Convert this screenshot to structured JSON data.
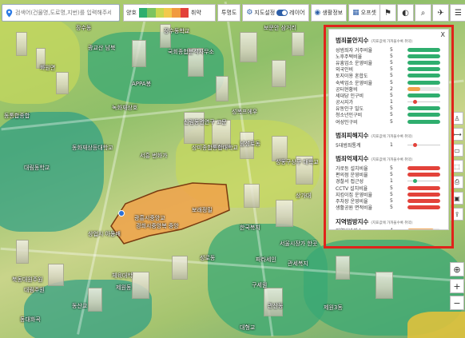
{
  "search": {
    "placeholder": "검색어(건물명,도로명,지번)를 입력해주세요."
  },
  "legend": {
    "safe_label": "양호",
    "danger_label": "취약",
    "colors": [
      "#2fae6e",
      "#7cc45f",
      "#c9d64f",
      "#f2c94c",
      "#f19a3e",
      "#e3423a"
    ]
  },
  "toolbar": {
    "opacity_label": "투명도",
    "map_setting_label": "지도설정",
    "layer_label": "레이어",
    "life_info_label": "생활정보",
    "off_label": "오프셋"
  },
  "colors": {
    "accent": "#2c5ea8",
    "highlight": "#e0231b",
    "good": "#2fae6e",
    "mid": "#f0a24a",
    "bad": "#e3423a"
  },
  "panel": {
    "close_label": "X",
    "sections": [
      {
        "title": "범죄불안지수",
        "note": "(지표값에 가까울수록 취약)",
        "rows": [
          {
            "label": "성범죄자 거주비율",
            "value": "5",
            "level": 1.0,
            "color": "#2fae6e"
          },
          {
            "label": "노후주택비율",
            "value": "5",
            "level": 1.0,
            "color": "#2fae6e"
          },
          {
            "label": "유흥업소 운영비율",
            "value": "5",
            "level": 1.0,
            "color": "#2fae6e"
          },
          {
            "label": "외국인비",
            "value": "5",
            "level": 1.0,
            "color": "#2fae6e"
          },
          {
            "label": "토지이용 혼합도",
            "value": "5",
            "level": 1.0,
            "color": "#2fae6e"
          },
          {
            "label": "숙박업소 운영비율",
            "value": "5",
            "level": 1.0,
            "color": "#2fae6e"
          },
          {
            "label": "공터현황비",
            "value": "2",
            "level": 0.4,
            "color": "#f0a24a"
          },
          {
            "label": "세대당 인구비",
            "value": "5",
            "level": 1.0,
            "color": "#2fae6e"
          },
          {
            "label": "공시지가",
            "value": "1",
            "level": 0.2,
            "color": "#e3423a",
            "style": "dot"
          },
          {
            "label": "유동인구 밀도",
            "value": "5",
            "level": 1.0,
            "color": "#2fae6e"
          },
          {
            "label": "청소년인구비",
            "value": "5",
            "level": 1.0,
            "color": "#2fae6e"
          },
          {
            "label": "여성인구비",
            "value": "5",
            "level": 1.0,
            "color": "#2fae6e"
          }
        ]
      },
      {
        "title": "범죄피해지수",
        "note": "(지표값에 가까울수록 취약)",
        "rows": [
          {
            "label": "5대범죄통계",
            "value": "1",
            "level": 0.2,
            "color": "#e3423a",
            "style": "dot"
          }
        ]
      },
      {
        "title": "범죄억제지수",
        "note": "(지표값에 가까울수록 취약)",
        "rows": [
          {
            "label": "가로등 설치비율",
            "value": "5",
            "level": 1.0,
            "color": "#e3423a"
          },
          {
            "label": "편의점 운영비율",
            "value": "5",
            "level": 1.0,
            "color": "#e3423a"
          },
          {
            "label": "경찰서 접근성",
            "value": "1",
            "level": 0.2,
            "color": "#2fae6e",
            "style": "dot"
          },
          {
            "label": "CCTV 설치비율",
            "value": "5",
            "level": 1.0,
            "color": "#e3423a"
          },
          {
            "label": "지킴이집 운영비율",
            "value": "5",
            "level": 1.0,
            "color": "#e3423a"
          },
          {
            "label": "주차장 운영비율",
            "value": "5",
            "level": 1.0,
            "color": "#e3423a"
          },
          {
            "label": "생활공원 면적비율",
            "value": "5",
            "level": 1.0,
            "color": "#e3423a"
          }
        ]
      },
      {
        "title": "지역범방지수",
        "note": "(지표값에 가까울수록 취약)",
        "rows": [
          {
            "label": "지역범방지수",
            "value": "4",
            "level": 0.8,
            "color": "#f0a24a"
          }
        ]
      }
    ]
  },
  "map_labels": [
    "장수동",
    "장수동학교",
    "보문안 삼거리",
    "광교산 남북",
    "국회종합분석사무소",
    "화원면",
    "동통합종합",
    "녹화재상호",
    "APPA봉",
    "동화재상등대학교",
    "상미종합통합대학교",
    "서흥 번화가",
    "신림동면연구 고문",
    "대림동학교",
    "성동구상구 대학교",
    "성복프에우",
    "남성로동",
    "광흥시중앙교",
    "경희시중앙복 중앙",
    "상업시 아동배",
    "한국복지",
    "보래정밀",
    "서울시장가 한곳",
    "상가대",
    "파라세인",
    "성로동",
    "관세복지",
    "북동대원주원",
    "대림주원",
    "동대화곡",
    "동산교",
    "구세원",
    "관산동",
    "체육대학",
    "제원동",
    "제원3동",
    "대형교"
  ]
}
